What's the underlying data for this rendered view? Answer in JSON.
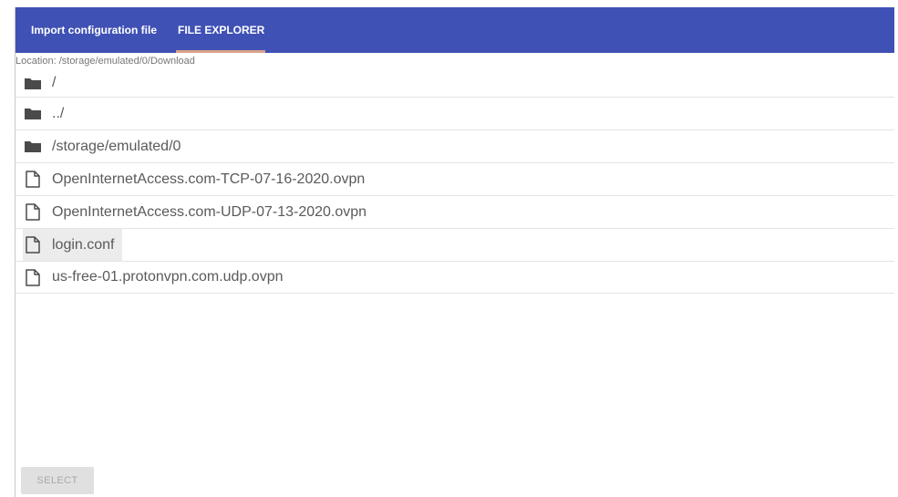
{
  "tabs": [
    {
      "label": "Import configuration file",
      "active": false
    },
    {
      "label": "FILE EXPLORER",
      "active": true
    }
  ],
  "location": "Location: /storage/emulated/0/Download",
  "entries": [
    {
      "type": "folder",
      "label": "/",
      "icon": "folder-icon"
    },
    {
      "type": "folder",
      "label": "../",
      "icon": "folder-icon"
    },
    {
      "type": "folder",
      "label": "/storage/emulated/0",
      "icon": "folder-icon"
    },
    {
      "type": "file",
      "label": "OpenInternetAccess.com-TCP-07-16-2020.ovpn",
      "icon": "file-icon"
    },
    {
      "type": "file",
      "label": "OpenInternetAccess.com-UDP-07-13-2020.ovpn",
      "icon": "file-icon"
    },
    {
      "type": "file",
      "label": "login.conf",
      "icon": "file-icon",
      "highlighted": true
    },
    {
      "type": "file",
      "label": "us-free-01.protonvpn.com.udp.ovpn",
      "icon": "file-icon"
    }
  ],
  "select_button": "SELECT",
  "colors": {
    "tabbar": "#3f51b5",
    "indicator": "#d9a28b"
  }
}
